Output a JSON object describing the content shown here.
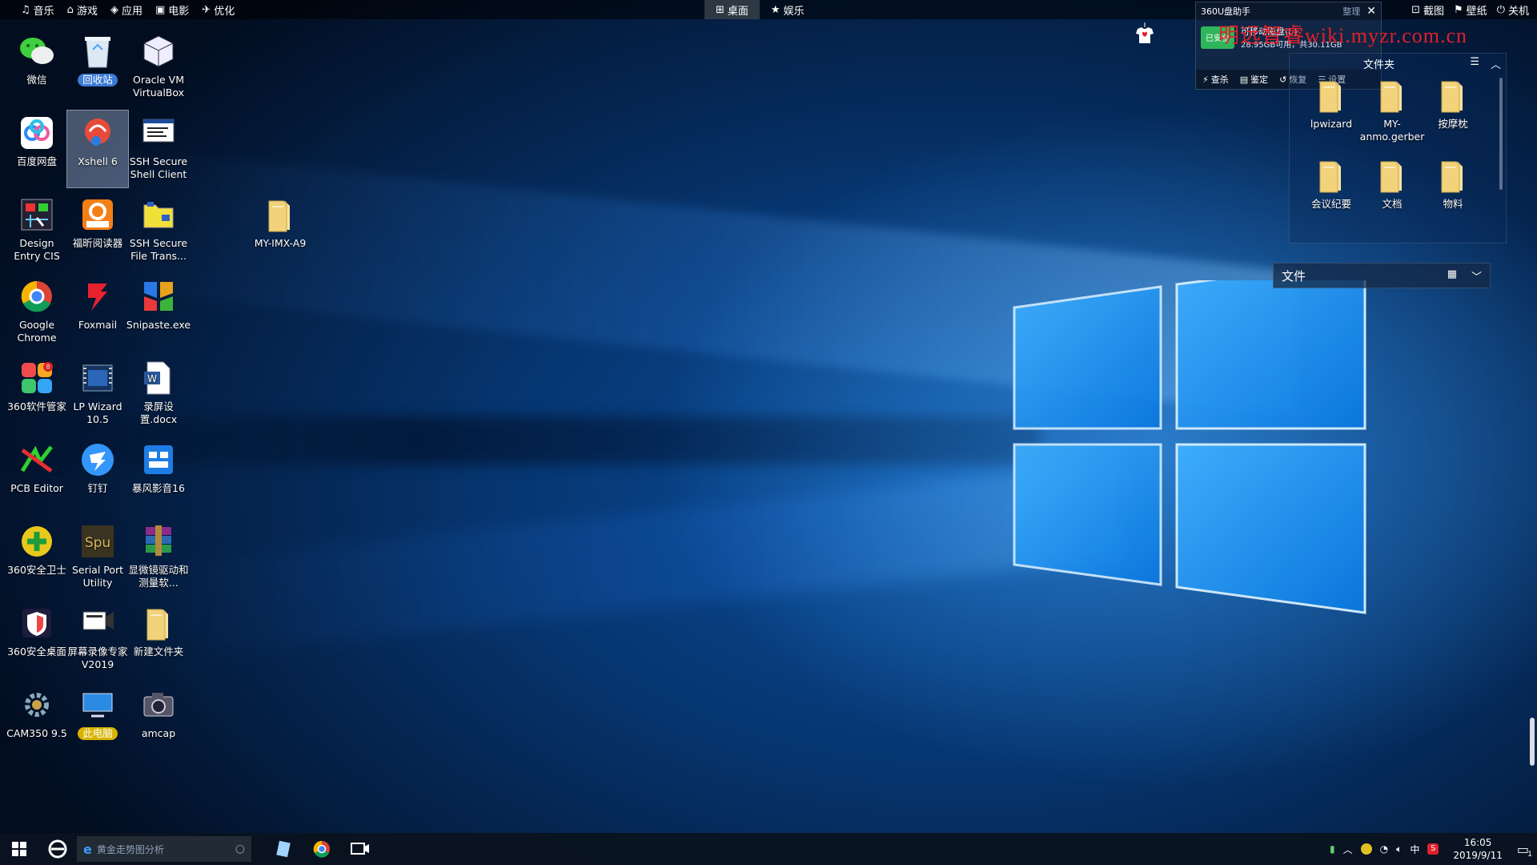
{
  "topbar": {
    "left": [
      {
        "icon": "music-note-icon",
        "label": "音乐"
      },
      {
        "icon": "gamepad-icon",
        "label": "游戏"
      },
      {
        "icon": "cube-icon",
        "label": "应用"
      },
      {
        "icon": "film-icon",
        "label": "电影"
      },
      {
        "icon": "rocket-icon",
        "label": "优化"
      }
    ],
    "center": [
      {
        "icon": "windows-flag-icon",
        "label": "桌面",
        "active": true
      },
      {
        "icon": "star-icon",
        "label": "娱乐",
        "active": false
      }
    ],
    "right": [
      {
        "icon": "screenshot-icon",
        "label": "截图"
      },
      {
        "icon": "shirt-icon",
        "label": "壁纸"
      },
      {
        "icon": "power-icon",
        "label": "关机"
      }
    ]
  },
  "desktop": {
    "columns": [
      [
        {
          "label": "微信",
          "icon": "wechat-icon"
        },
        {
          "label": "百度网盘",
          "icon": "baidu-netdisk-icon"
        },
        {
          "label": "Design Entry CIS",
          "icon": "design-entry-icon"
        },
        {
          "label": "Google Chrome",
          "icon": "chrome-icon"
        },
        {
          "label": "360软件管家",
          "icon": "360-software-icon"
        },
        {
          "label": "PCB Editor",
          "icon": "pcb-editor-icon"
        },
        {
          "label": "360安全卫士",
          "icon": "360-security-icon"
        },
        {
          "label": "360安全桌面",
          "icon": "360-desktop-icon"
        },
        {
          "label": "CAM350 9.5",
          "icon": "cam350-icon"
        }
      ],
      [
        {
          "label": "回收站",
          "icon": "recycle-bin-icon",
          "pill": "#3a7bd5"
        },
        {
          "label": "Xshell 6",
          "icon": "xshell-icon",
          "selected": true
        },
        {
          "label": "福昕阅读器",
          "icon": "foxit-reader-icon"
        },
        {
          "label": "Foxmail",
          "icon": "foxmail-icon"
        },
        {
          "label": "LP Wizard 10.5",
          "icon": "lp-wizard-icon"
        },
        {
          "label": "钉钉",
          "icon": "dingtalk-icon"
        },
        {
          "label": "Serial Port Utility",
          "icon": "serial-port-icon"
        },
        {
          "label": "屏幕录像专家V2019",
          "icon": "screen-recorder-icon"
        },
        {
          "label": "此电脑",
          "icon": "this-pc-icon",
          "pill": "#d8b400"
        }
      ],
      [
        {
          "label": "Oracle VM VirtualBox",
          "icon": "virtualbox-icon"
        },
        {
          "label": "SSH Secure Shell Client",
          "icon": "ssh-client-icon"
        },
        {
          "label": "SSH Secure File Trans...",
          "icon": "ssh-file-transfer-icon"
        },
        {
          "label": "Snipaste.exe",
          "icon": "snipaste-icon"
        },
        {
          "label": "录屏设置.docx",
          "icon": "word-document-icon"
        },
        {
          "label": "暴风影音16",
          "icon": "storm-player-icon"
        },
        {
          "label": "显微镜驱动和测量软...",
          "icon": "winrar-archive-icon"
        },
        {
          "label": "新建文件夹",
          "icon": "folder-icon"
        },
        {
          "label": "amcap",
          "icon": "camera-icon"
        }
      ]
    ],
    "loose": [
      {
        "label": "MY-IMX-A9",
        "icon": "folder-icon"
      }
    ]
  },
  "usb_widget": {
    "title": "360U盘助手",
    "menu_label": "整理",
    "status": "已安全",
    "device": "可移动磁盘(I:)",
    "capacity": "28.95GB可用，共30.11GB",
    "actions": [
      {
        "icon": "bolt-icon",
        "label": "查杀"
      },
      {
        "icon": "trash-icon",
        "label": "鉴定"
      },
      {
        "icon": "restore-icon",
        "label": "恢复"
      },
      {
        "icon": "list-icon",
        "label": "设置"
      }
    ]
  },
  "watermark": "明远智睿wiki.myzr.com.cn",
  "fence": {
    "title": "文件夹",
    "items": [
      {
        "label": "lpwizard",
        "icon": "folder-icon"
      },
      {
        "label": "MY-anmo.gerber",
        "icon": "folder-icon"
      },
      {
        "label": "按摩枕",
        "icon": "folder-icon"
      },
      {
        "label": "会议纪要",
        "icon": "folder-icon"
      },
      {
        "label": "文档",
        "icon": "folder-icon"
      },
      {
        "label": "物料",
        "icon": "folder-icon"
      }
    ]
  },
  "fence2": {
    "title": "文件"
  },
  "taskbar": {
    "search_placeholder": "黄金走势图分析",
    "time": "16:05",
    "date": "2019/9/11",
    "ime": "中",
    "notification_count": "1"
  },
  "colors": {
    "accent": "#1e90ff",
    "folder": "#f2d27a",
    "watermark": "#e0202a"
  }
}
